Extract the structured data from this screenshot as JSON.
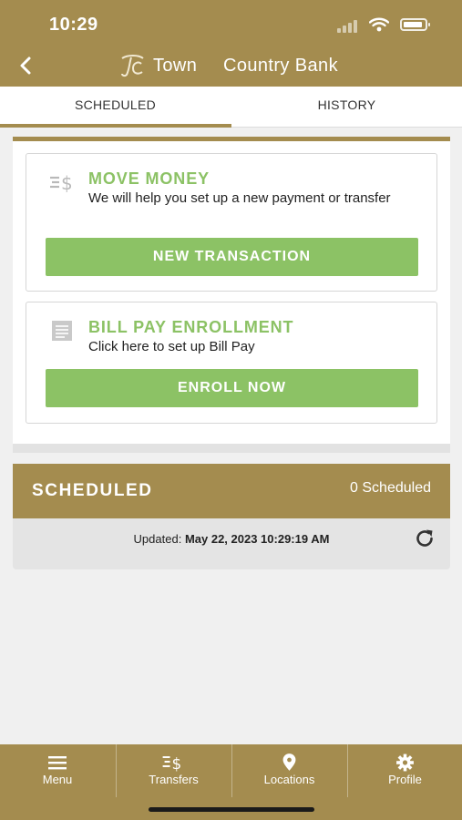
{
  "status_bar": {
    "time": "10:29"
  },
  "header": {
    "back_icon": "chevron-left-icon",
    "logo_icon": "tcb-monogram-icon",
    "brand_part1": "Town",
    "brand_part2": "Country Bank",
    "color": "#a48c4f"
  },
  "tabs": [
    {
      "label": "SCHEDULED",
      "active": true
    },
    {
      "label": "HISTORY",
      "active": false
    }
  ],
  "cards": [
    {
      "icon": "transfer-dollar-icon",
      "title": "MOVE MONEY",
      "description": "We will help you set up a new payment or transfer",
      "button_label": "NEW TRANSACTION"
    },
    {
      "icon": "bill-document-icon",
      "title": "BILL PAY ENROLLMENT",
      "description": "Click here to set up Bill Pay",
      "button_label": "ENROLL NOW"
    }
  ],
  "scheduled": {
    "title": "SCHEDULED",
    "count_label": "0 Scheduled",
    "updated_prefix": "Updated:",
    "updated_value": "May 22, 2023 10:29:19 AM",
    "refresh_icon": "refresh-icon"
  },
  "bottom_nav": [
    {
      "label": "Menu",
      "icon": "menu-icon"
    },
    {
      "label": "Transfers",
      "icon": "transfer-dollar-icon"
    },
    {
      "label": "Locations",
      "icon": "location-pin-icon"
    },
    {
      "label": "Profile",
      "icon": "gear-icon"
    }
  ],
  "colors": {
    "accent_gold": "#a48c4f",
    "action_green": "#8cc265",
    "background": "#f0f0f0"
  }
}
